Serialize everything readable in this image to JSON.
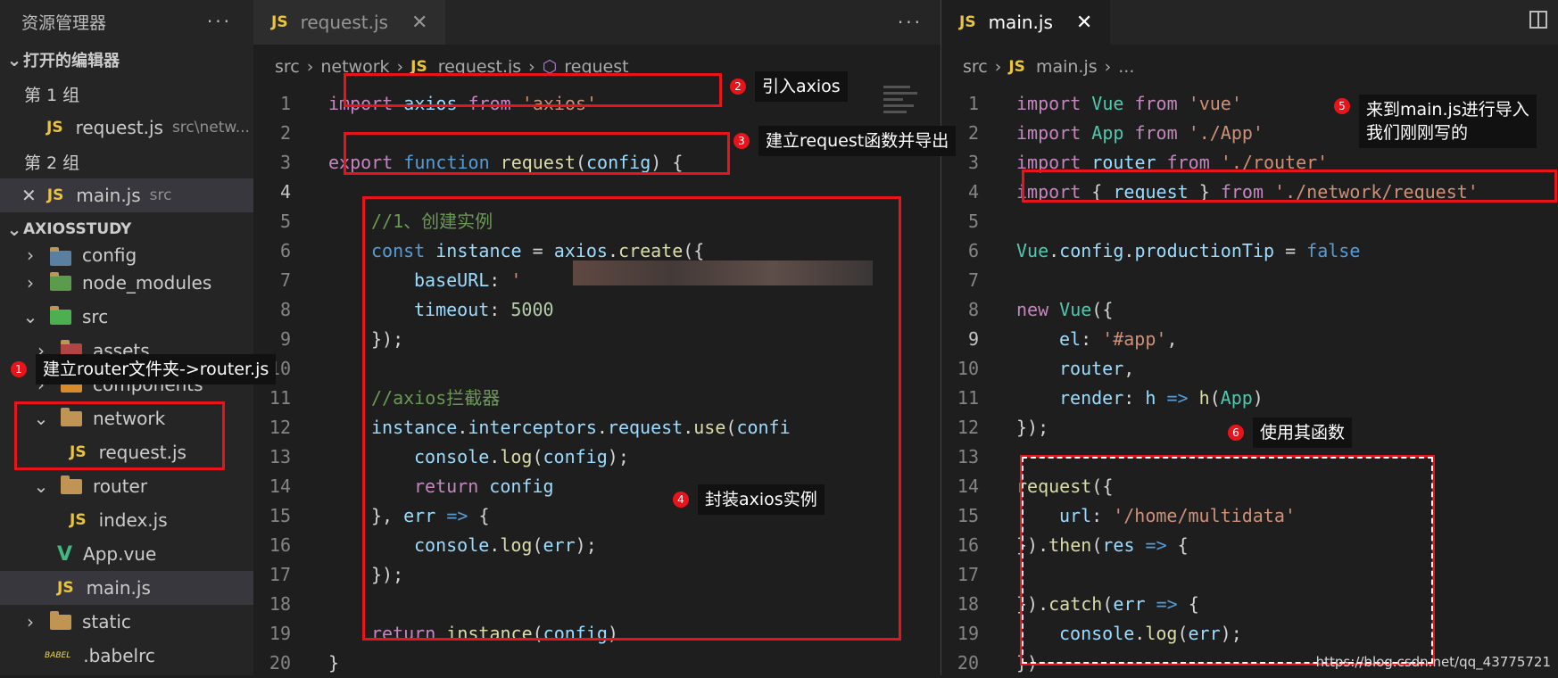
{
  "explorer": {
    "title": "资源管理器",
    "more": "···",
    "open_editors": "打开的编辑器",
    "group1": "第 1 组",
    "group1_file": "request.js",
    "group1_desc": "src\\netw...",
    "group2": "第 2 组",
    "group2_file": "main.js",
    "group2_desc": "src",
    "project": "AXIOSSTUDY",
    "tree": [
      "config",
      "node_modules",
      "src",
      "assets",
      "components",
      "network",
      "request.js",
      "router",
      "index.js",
      "App.vue",
      "main.js",
      "static",
      ".babelrc"
    ]
  },
  "left_editor": {
    "tab": "request.js",
    "breadcrumb": [
      "src",
      "network",
      "request.js",
      "request"
    ],
    "code": [
      "import axios from 'axios'",
      "",
      "export function request(config) {",
      "",
      "//1、创建实例",
      "const instance = axios.create({",
      "baseURL: '",
      "timeout: 5000",
      "});",
      "",
      "//axios拦截器",
      "instance.interceptors.request.use(confi",
      "console.log(config);",
      "return config",
      "}, err => {",
      "console.log(err);",
      "});",
      "",
      "return instance(config)",
      "}"
    ]
  },
  "right_editor": {
    "tab": "main.js",
    "breadcrumb": [
      "src",
      "main.js",
      "..."
    ],
    "code": [
      "import Vue from 'vue'",
      "import App from './App'",
      "import router from './router'",
      "import { request } from './network/request'",
      "",
      "Vue.config.productionTip = false",
      "",
      "new Vue({",
      "el: '#app',",
      "router,",
      "render: h => h(App)",
      "});",
      "",
      "request({",
      "url: '/home/multidata'",
      "}).then(res => {",
      "",
      "}).catch(err => {",
      "console.log(err);",
      "})"
    ]
  },
  "annotations": [
    {
      "n": "1",
      "text": "建立router文件夹->router.js"
    },
    {
      "n": "2",
      "text": "引入axios"
    },
    {
      "n": "3",
      "text": "建立request函数并导出"
    },
    {
      "n": "4",
      "text": "封装axios实例"
    },
    {
      "n": "5",
      "text": "来到main.js进行导入\n我们刚刚写的"
    },
    {
      "n": "6",
      "text": "使用其函数"
    }
  ],
  "watermark": "https://blog.csdn.net/qq_43775721"
}
